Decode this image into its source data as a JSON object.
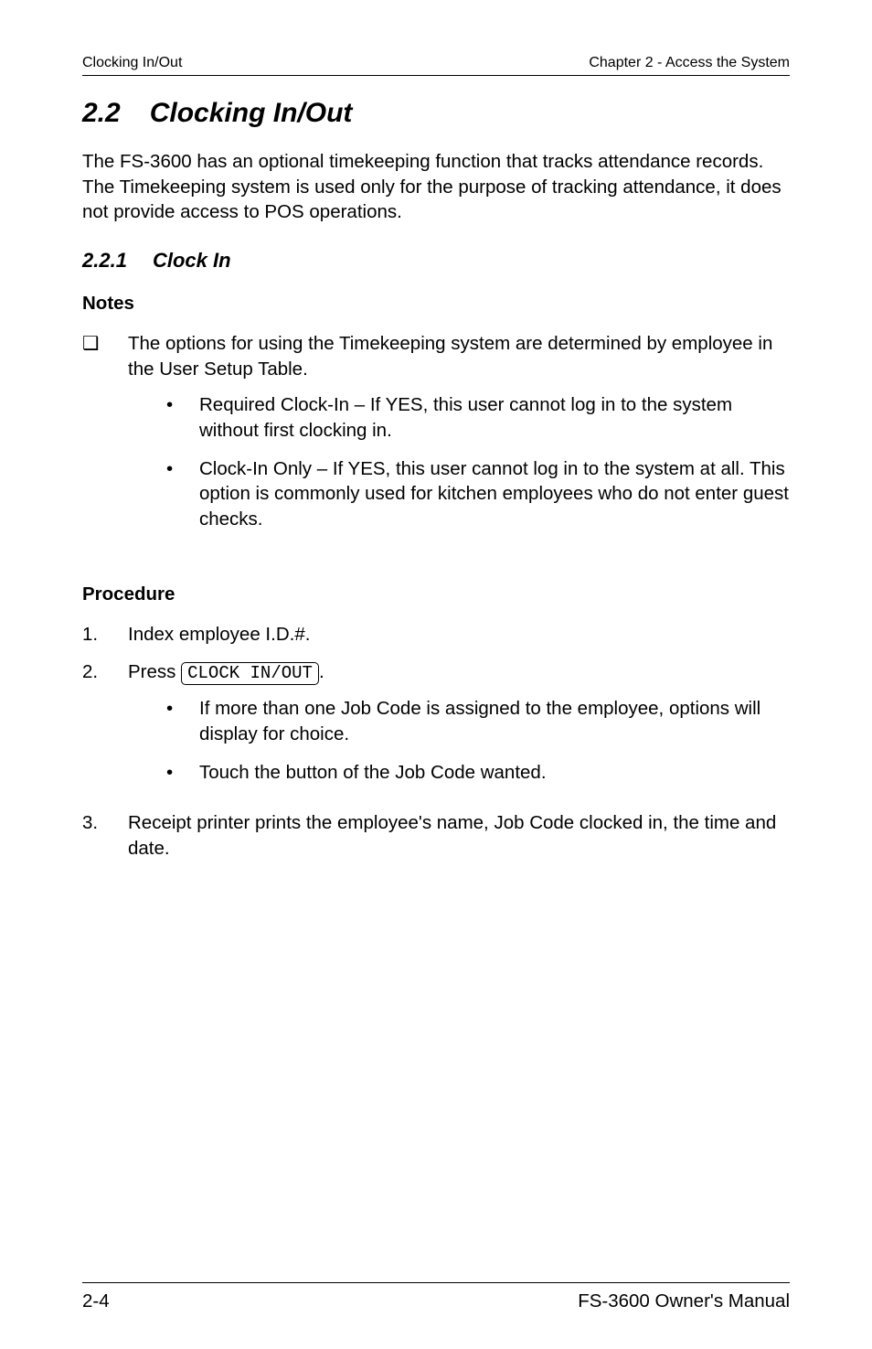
{
  "header": {
    "left": "Clocking In/Out",
    "right": "Chapter 2 - Access the System"
  },
  "section": {
    "number": "2.2",
    "title": "Clocking In/Out"
  },
  "intro": "The FS-3600 has an optional timekeeping function that tracks attendance records.  The Timekeeping system is used only for the purpose of tracking attendance, it does not provide access to POS operations.",
  "subsection": {
    "number": "2.2.1",
    "title": "Clock In"
  },
  "notes_heading": "Notes",
  "note_main": "The options for using the Timekeeping system are determined by employee in the User Setup Table.",
  "note_bullets": [
    "Required Clock-In – If YES, this user cannot log in to the system without first clocking in.",
    "Clock-In Only – If YES, this user cannot log in to the system at all.  This option is commonly used for kitchen employees who do not enter guest checks."
  ],
  "procedure_heading": "Procedure",
  "proc1": "Index employee I.D.#.",
  "proc2_prefix": "Press ",
  "proc2_key": "CLOCK IN/OUT",
  "proc2_suffix": ".",
  "proc2_bullets": [
    "If more than one Job Code is assigned to the employee, options will display for choice.",
    "Touch the button of the Job Code wanted."
  ],
  "proc3": "Receipt printer prints the employee's name, Job Code clocked in, the time and date.",
  "footer": {
    "left": "2-4",
    "right": "FS-3600 Owner's Manual"
  }
}
